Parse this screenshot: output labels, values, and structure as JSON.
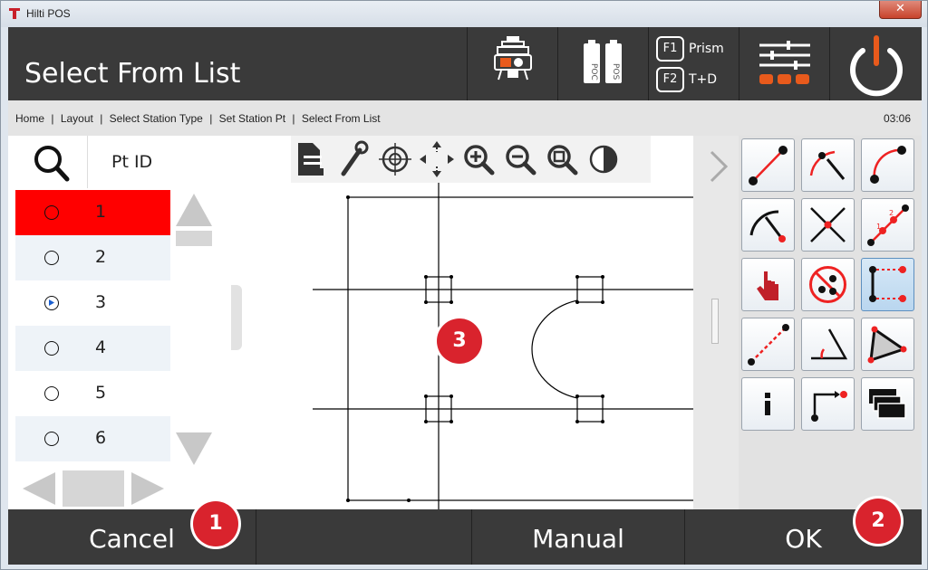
{
  "window": {
    "title": "Hilti POS"
  },
  "header": {
    "page_title": "Select From List",
    "f1_key": "F1",
    "f1_label": "Prism",
    "f2_key": "F2",
    "f2_label": "T+D",
    "battery_left": "POC",
    "battery_right": "POS"
  },
  "breadcrumb": {
    "items": [
      "Home",
      "Layout",
      "Select Station Type",
      "Set Station Pt",
      "Select From List"
    ],
    "separator": "|",
    "time": "03:06"
  },
  "list": {
    "column_header": "Pt ID",
    "rows": [
      {
        "label": "1",
        "selected": true
      },
      {
        "label": "2",
        "selected": false
      },
      {
        "label": "3",
        "selected": false
      },
      {
        "label": "4",
        "selected": false
      },
      {
        "label": "5",
        "selected": false
      },
      {
        "label": "6",
        "selected": false
      }
    ]
  },
  "map": {
    "point_marker": "3"
  },
  "footer": {
    "cancel_label": "Cancel",
    "manual_label": "Manual",
    "ok_label": "OK"
  },
  "callouts": {
    "cancel": "1",
    "ok": "2"
  },
  "colors": {
    "accent": "#ff0000",
    "callout": "#d9232d",
    "bar": "#3a3a3a"
  },
  "icons": [
    "tripod-icon",
    "battery-icon",
    "settings-sliders-icon",
    "power-icon",
    "search-icon",
    "document-icon",
    "wrench-icon",
    "crosshair-icon",
    "pan-icon",
    "zoom-in-icon",
    "zoom-out-icon",
    "zoom-fit-icon",
    "contrast-icon"
  ]
}
